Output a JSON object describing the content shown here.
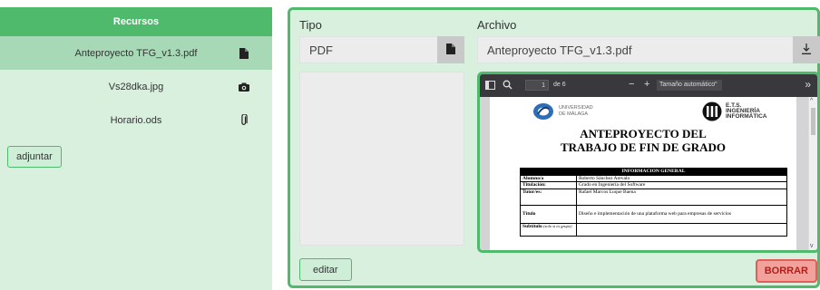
{
  "resources": {
    "header": "Recursos",
    "items": [
      {
        "name": "Anteproyecto TFG_v1.3.pdf",
        "icon": "file-icon",
        "active": true
      },
      {
        "name": "Vs28dka.jpg",
        "icon": "camera-icon",
        "active": false
      },
      {
        "name": "Horario.ods",
        "icon": "paperclip-icon",
        "active": false
      }
    ],
    "attach_label": "adjuntar"
  },
  "editor": {
    "tipo_label": "Tipo",
    "tipo_value": "PDF",
    "archivo_label": "Archivo",
    "archivo_value": "Anteproyecto TFG_v1.3.pdf",
    "edit_label": "editar",
    "delete_label": "BORRAR"
  },
  "viewer": {
    "page_number": "1",
    "page_of": "de 6",
    "zoom_minus": "−",
    "zoom_plus": "+",
    "zoom_label": "Tamaño automático",
    "more": "»",
    "doc": {
      "uni_line1": "UNIVERSIDAD",
      "uni_line2": "DE MÁLAGA",
      "ets_line1": "E.T.S.",
      "ets_line2": "INGENIERÍA",
      "ets_line3": "INFORMÁTICA",
      "title_line1": "ANTEPROYECTO DEL",
      "title_line2": "TRABAJO DE FIN DE GRADO",
      "table_header": "INFORMACION GENERAL",
      "rows": [
        {
          "k": "Alumno/a",
          "v": "Roberto Sánchez Arevalo"
        },
        {
          "k": "Titulación:",
          "v": "Grado en Ingeniería del Software"
        },
        {
          "k": "Tutor/es:",
          "v": "Rafael Marcos Luque Baena"
        },
        {
          "k": "Título",
          "v": "Diseño e implementación de una plataforma web para empresas de servicios"
        },
        {
          "k": "Subtítulo",
          "v": ""
        }
      ],
      "subtitle_note": "(solo si es grupo)"
    }
  },
  "colors": {
    "accent": "#4fba6c",
    "panel_bg": "#d9f0df",
    "danger": "#e06058"
  }
}
